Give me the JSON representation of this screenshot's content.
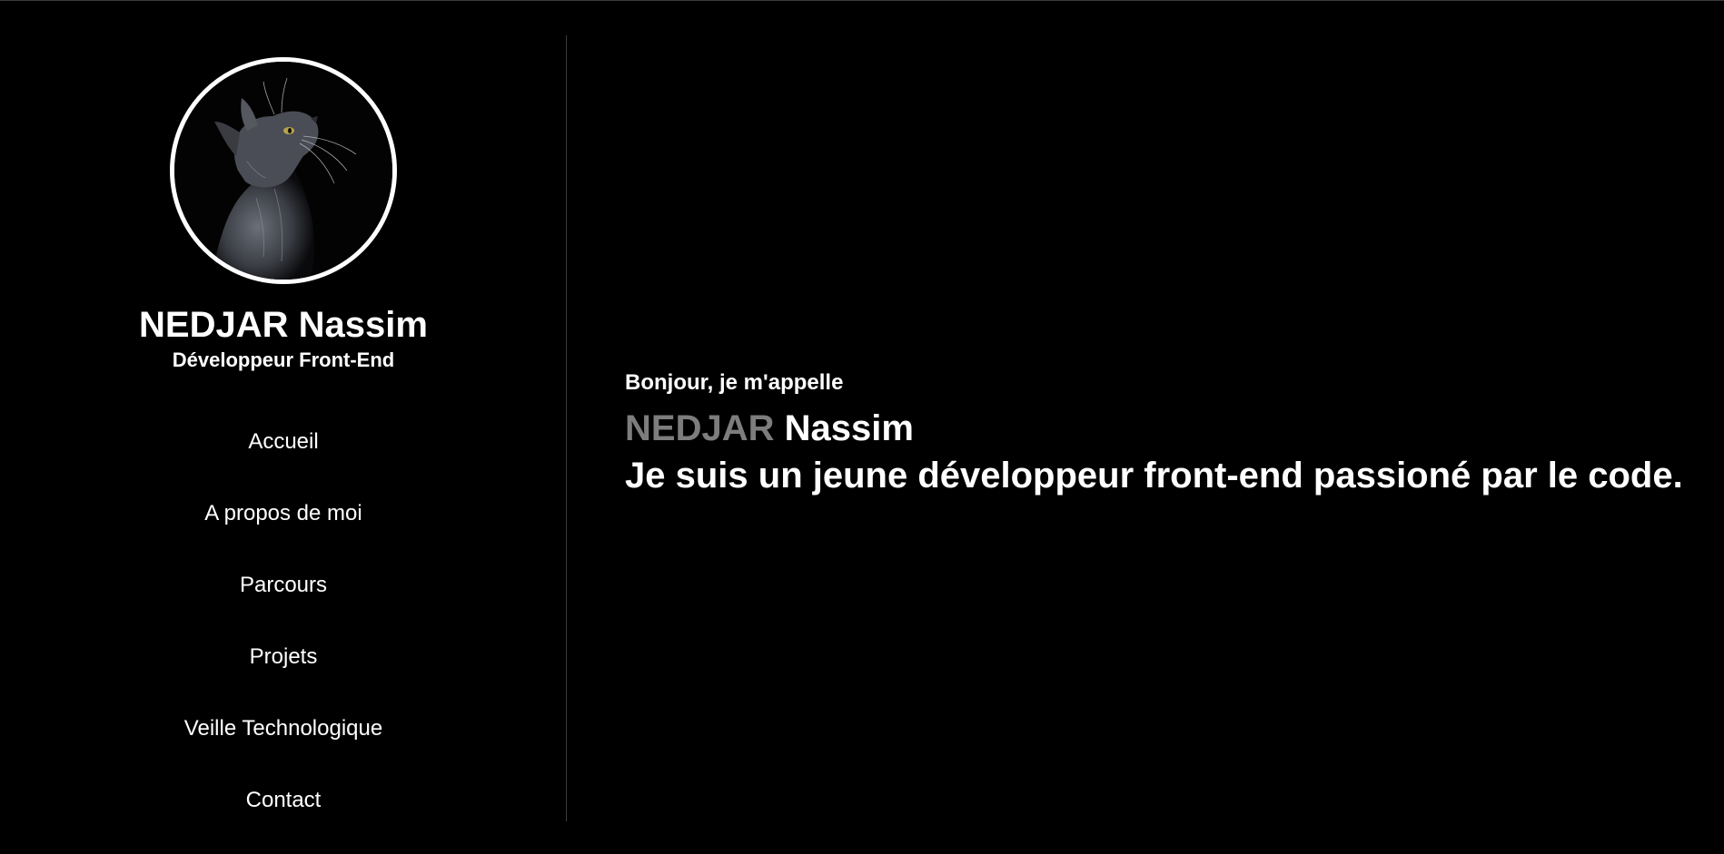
{
  "profile": {
    "name": "NEDJAR Nassim",
    "role": "Développeur Front-End"
  },
  "nav": {
    "items": [
      {
        "label": "Accueil"
      },
      {
        "label": "A propos de moi"
      },
      {
        "label": "Parcours"
      },
      {
        "label": "Projets"
      },
      {
        "label": "Veille Technologique"
      },
      {
        "label": "Contact"
      }
    ]
  },
  "hero": {
    "greeting": "Bonjour, je m'appelle",
    "last_name": "NEDJAR",
    "first_name": "Nassim",
    "tagline": "Je suis un jeune développeur front-end passioné par le code."
  },
  "colors": {
    "background": "#000000",
    "text": "#ffffff",
    "accent_muted": "#7d7d7d",
    "divider": "#3d3d3d"
  },
  "icons": {
    "avatar": "cat-silhouette-photo"
  }
}
